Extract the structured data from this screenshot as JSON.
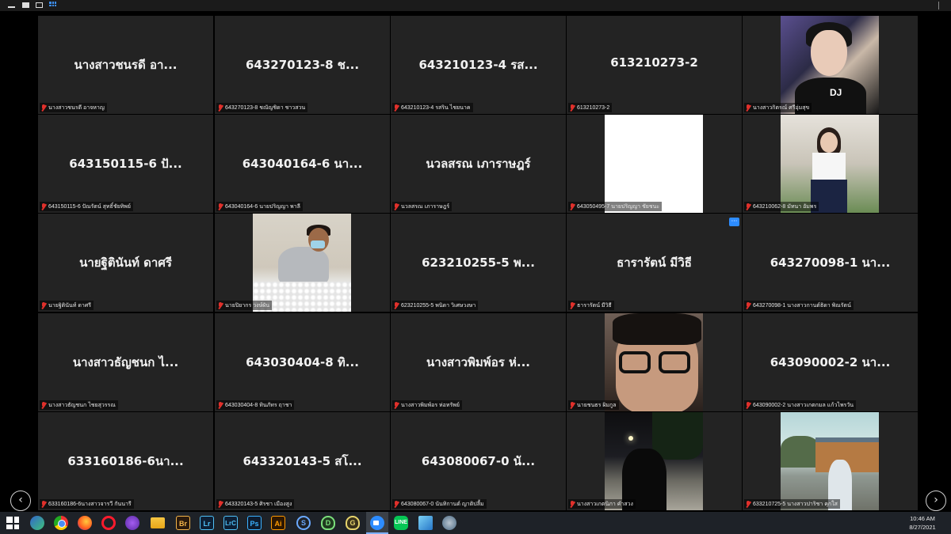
{
  "window": {
    "top_icons": [
      "minimize-icon",
      "maximize-icon",
      "restore-icon",
      "gallery-view-icon"
    ]
  },
  "tiles": [
    {
      "name": "นางสาวชนรดี อา...",
      "label": "นางสาวชนรดี อาจหาญ",
      "video": null
    },
    {
      "name": "643270123-8 ช...",
      "label": "643270123-8 ชณัญชิดา ชาวสวน",
      "video": null
    },
    {
      "name": "643210123-4 รส...",
      "label": "643210123-4 รสริน ไชยนาค",
      "video": null
    },
    {
      "name": "613210273-2",
      "label": "613210273-2",
      "video": null
    },
    {
      "name": "",
      "label": "นางสาวกิตรณ์ ศรีอุ่มสุข",
      "video": "v-dj"
    },
    {
      "name": "643150115-6 ปั...",
      "label": "643150115-6 ปัณรัตน์ สุทธิ์ชัยทิพย์",
      "video": null
    },
    {
      "name": "643040164-6 นา...",
      "label": "643040164-6 นายปริญญา พาลี",
      "video": null
    },
    {
      "name": "นวลสรณ เภาราษฎร์",
      "label": "นวลสรณ เภาราษฎร์",
      "video": null
    },
    {
      "name": "",
      "label": "643050495-7 นายปริญญา ชัยชนะ",
      "video": "v-white"
    },
    {
      "name": "",
      "label": "643210062-8 มัทนา อัมพร",
      "video": "v-girl"
    },
    {
      "name": "นายฐิตินันท์ ดาศรี",
      "label": "นายฐิตินันท์ ดาศรี",
      "video": null
    },
    {
      "name": "",
      "label": "นายปิยากร วงษ์ผัน",
      "video": "v-man"
    },
    {
      "name": "623210255-5 พ...",
      "label": "623210255-5 พนิดา วิเศษวงษา",
      "video": null
    },
    {
      "name": "ธารารัตน์ มีวิธี",
      "label": "ธารารัตน์ มีวิธี",
      "video": null
    },
    {
      "name": "643270098-1 นา...",
      "label": "643270098-1 นางสาวกานต์ธิดา พิณรัตน์",
      "video": null
    },
    {
      "name": "นางสาวธัญชนก ไ...",
      "label": "นางสาวธัญชนก ไชยสุวรรณ",
      "video": null
    },
    {
      "name": "643030404-8 ทิ...",
      "label": "643030404-8 ทินภัทร ฤาชา",
      "video": null
    },
    {
      "name": "นางสาวพิมพ์อร ห่...",
      "label": "นางสาวพิมพ์อร ห่อทรัพย์",
      "video": null
    },
    {
      "name": "",
      "label": "นายชนธร ผิมกูล",
      "video": "v-glasses"
    },
    {
      "name": "643090002-2 นา...",
      "label": "643090002-2 นางสาวเกตกมล แก้วไพรวัน",
      "video": null
    },
    {
      "name": "633160186-6นา...",
      "label": "633160186-6นางสาวจารวี กันนารี",
      "video": null
    },
    {
      "name": "643320143-5 สโ...",
      "label": "643320143-5 ศิรชา เมืองสูง",
      "video": null
    },
    {
      "name": "643080067-0 นั...",
      "label": "643080067-0 นันทิกานต์ ญาติปลื้ม",
      "video": null
    },
    {
      "name": "",
      "label": "นางสาวเกตนิภา คำสวง",
      "video": "v-night"
    },
    {
      "name": "",
      "label": "633210725-5 นางสาวปาริชา คุกใส",
      "video": "v-train"
    }
  ],
  "more_button": "···",
  "nav": {
    "prev": "‹",
    "next": "›"
  },
  "taskbar": {
    "apps": [
      "start-icon",
      "edge-icon",
      "chrome-icon",
      "firefox-icon",
      "opera-icon",
      "tor-icon",
      "file-explorer-icon",
      "Br",
      "Lr",
      "LrC",
      "Ps",
      "Ai",
      "S",
      "D",
      "G",
      "G",
      "zoom-icon",
      "LINE",
      "app-icon",
      "app-icon"
    ],
    "br": "Br",
    "lr": "Lr",
    "lrc": "LrC",
    "ps": "Ps",
    "ai": "Ai",
    "s": "S",
    "d": "D",
    "g1": "G",
    "g2": "G",
    "line": "LINE"
  },
  "clock": {
    "time": "10:46 AM",
    "date": "8/27/2021"
  }
}
